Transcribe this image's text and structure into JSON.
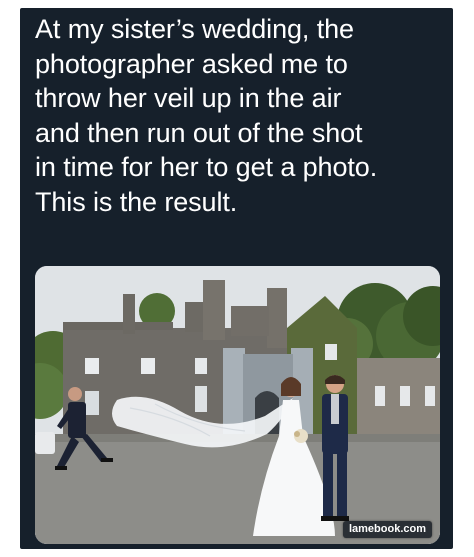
{
  "post": {
    "caption_lines": [
      "At my sister’s wedding, the",
      "photographer asked me to",
      "throw her veil up in the air",
      "and then run out of the shot",
      "in time for her to get a photo.",
      "This is the result."
    ]
  },
  "photo": {
    "watermark": "lamebook.com"
  },
  "colors": {
    "panel_background": "#16202b",
    "caption_text": "#ffffff"
  }
}
